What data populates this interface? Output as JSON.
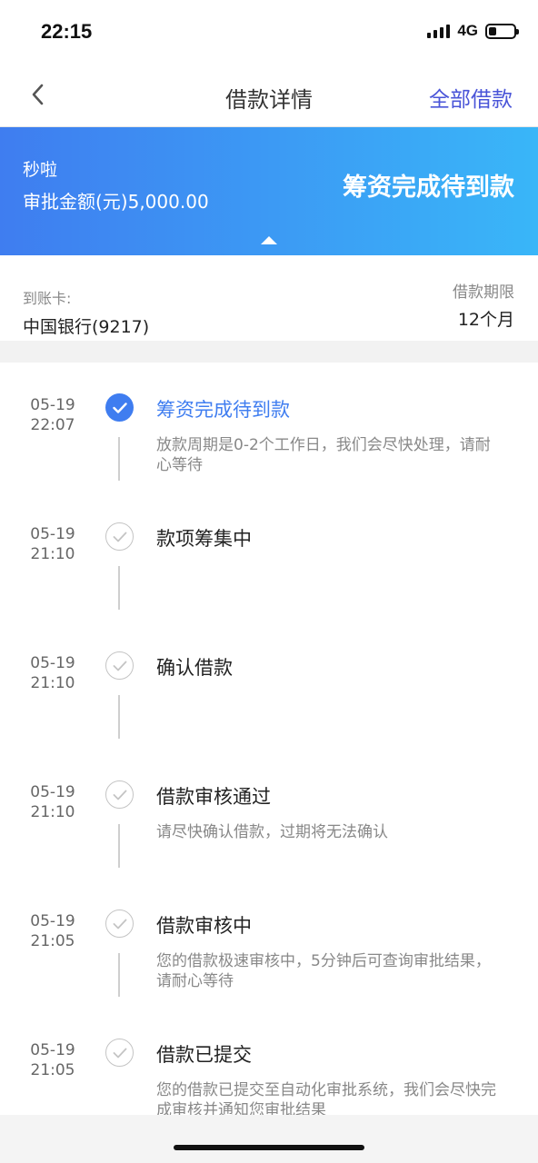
{
  "status_bar": {
    "time": "22:15",
    "network": "4G"
  },
  "nav": {
    "title": "借款详情",
    "right_action": "全部借款",
    "back_icon": "chevron-left-icon"
  },
  "banner": {
    "product_name": "秒啦",
    "amount_text": "审批金额(元)5,000.00",
    "status": "筹资完成待到款",
    "gradient_start": "#3f7df0",
    "gradient_end": "#39b6f8"
  },
  "card_info": {
    "card_label": "到账卡:",
    "card_value": "中国银行(9217)",
    "term_label": "借款期限",
    "term_value": "12个月"
  },
  "timeline": [
    {
      "date": "05-19",
      "time": "22:07",
      "title": "筹资完成待到款",
      "desc": "放款周期是0-2个工作日，我们会尽快处理，请耐心等待",
      "state": "active"
    },
    {
      "date": "05-19",
      "time": "21:10",
      "title": "款项筹集中",
      "desc": "",
      "state": "done"
    },
    {
      "date": "05-19",
      "time": "21:10",
      "title": "确认借款",
      "desc": "",
      "state": "done"
    },
    {
      "date": "05-19",
      "time": "21:10",
      "title": "借款审核通过",
      "desc": "请尽快确认借款，过期将无法确认",
      "state": "done"
    },
    {
      "date": "05-19",
      "time": "21:05",
      "title": "借款审核中",
      "desc": "您的借款极速审核中，5分钟后可查询审批结果，请耐心等待",
      "state": "done"
    },
    {
      "date": "05-19",
      "time": "21:05",
      "title": "借款已提交",
      "desc": "您的借款已提交至自动化审批系统，我们会尽快完成审核并通知您审批结果",
      "state": "done"
    }
  ],
  "colors": {
    "accent": "#3f7df0",
    "nav_action": "#4a55d8"
  }
}
